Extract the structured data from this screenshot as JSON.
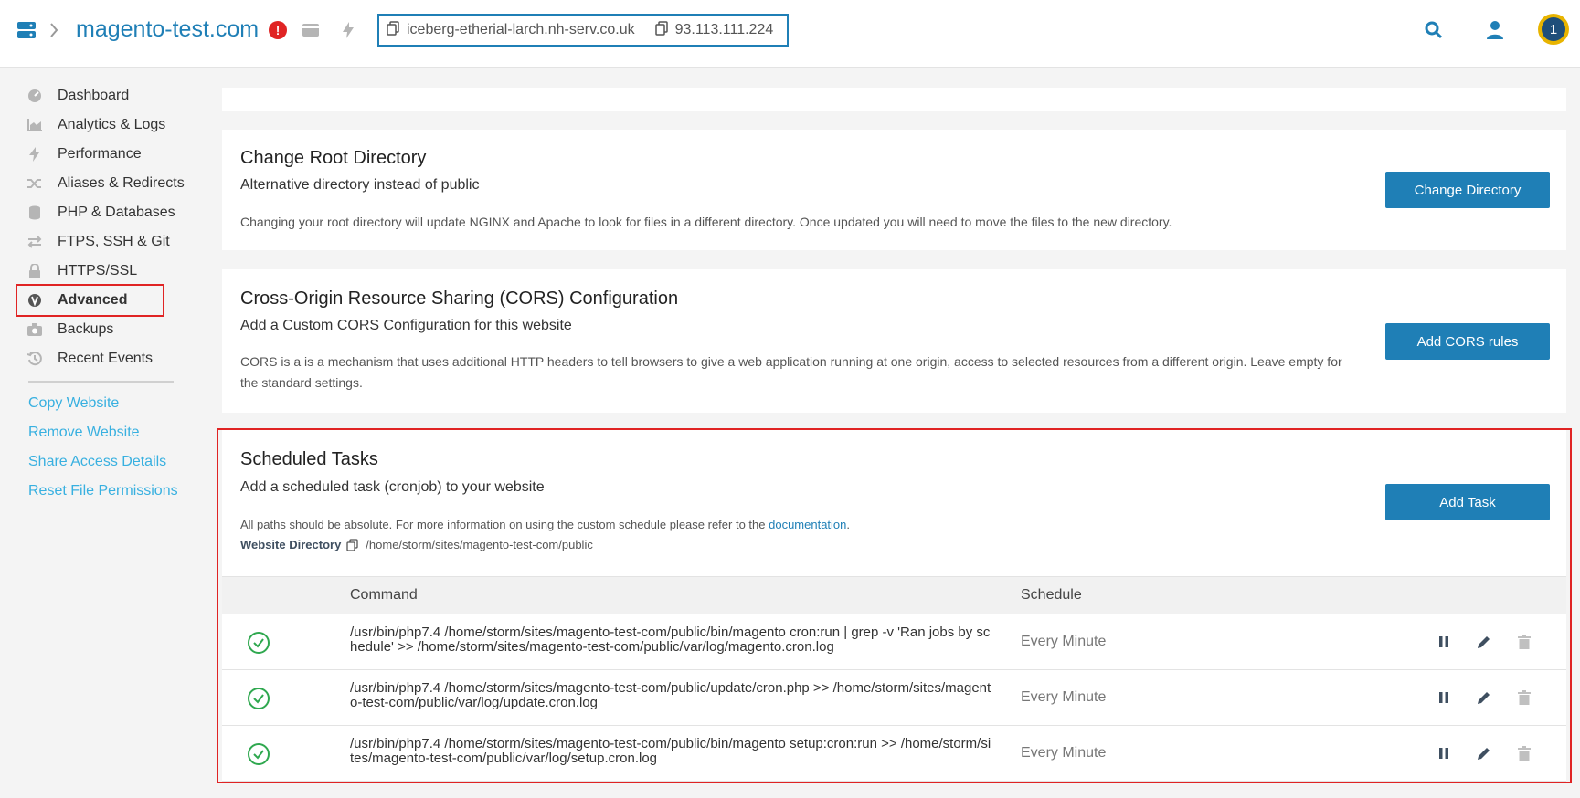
{
  "header": {
    "site_name": "magento-test.com",
    "alert_count": "!",
    "hostname": "iceberg-etherial-larch.nh-serv.co.uk",
    "ip_address": "93.113.111.224",
    "avatar_badge": "1"
  },
  "sidebar": {
    "items": [
      {
        "label": "Dashboard",
        "icon": "dashboard-icon"
      },
      {
        "label": "Analytics & Logs",
        "icon": "chart-icon"
      },
      {
        "label": "Performance",
        "icon": "bolt-icon"
      },
      {
        "label": "Aliases & Redirects",
        "icon": "shuffle-icon"
      },
      {
        "label": "PHP & Databases",
        "icon": "database-icon"
      },
      {
        "label": "FTPS, SSH & Git",
        "icon": "transfer-icon"
      },
      {
        "label": "HTTPS/SSL",
        "icon": "lock-icon"
      },
      {
        "label": "Advanced",
        "icon": "advanced-icon"
      },
      {
        "label": "Backups",
        "icon": "camera-icon"
      },
      {
        "label": "Recent Events",
        "icon": "history-icon"
      }
    ],
    "links": [
      "Copy Website",
      "Remove Website",
      "Share Access Details",
      "Reset File Permissions"
    ]
  },
  "root_dir": {
    "title": "Change Root Directory",
    "subtitle": "Alternative directory instead of public",
    "description": "Changing your root directory will update NGINX and Apache to look for files in a different directory. Once updated you will need to move the files to the new directory.",
    "button": "Change Directory"
  },
  "cors": {
    "title": "Cross-Origin Resource Sharing (CORS) Configuration",
    "subtitle": "Add a Custom CORS Configuration for this website",
    "description": "CORS is a is a mechanism that uses additional HTTP headers to tell browsers to give a web application running at one origin, access to selected resources from a different origin. Leave empty for the standard settings.",
    "button": "Add CORS rules"
  },
  "scheduled": {
    "title": "Scheduled Tasks",
    "subtitle": "Add a scheduled task (cronjob) to your website",
    "info_prefix": "All paths should be absolute. For more information on using the custom schedule please refer to the ",
    "info_link": "documentation",
    "info_suffix": ".",
    "webdir_label": "Website Directory",
    "webdir_path": "/home/storm/sites/magento-test-com/public",
    "button": "Add Task",
    "columns": {
      "command": "Command",
      "schedule": "Schedule"
    },
    "tasks": [
      {
        "command": "/usr/bin/php7.4 /home/storm/sites/magento-test-com/public/bin/magento cron:run | grep -v 'Ran jobs by schedule' >> /home/storm/sites/magento-test-com/public/var/log/magento.cron.log",
        "schedule": "Every Minute"
      },
      {
        "command": "/usr/bin/php7.4 /home/storm/sites/magento-test-com/public/update/cron.php >> /home/storm/sites/magento-test-com/public/var/log/update.cron.log",
        "schedule": "Every Minute"
      },
      {
        "command": "/usr/bin/php7.4 /home/storm/sites/magento-test-com/public/bin/magento setup:cron:run >> /home/storm/sites/magento-test-com/public/var/log/setup.cron.log",
        "schedule": "Every Minute"
      }
    ]
  },
  "colors": {
    "accent": "#1f7fb6",
    "link": "#38b0e0",
    "alert": "#e02424",
    "success": "#2fa84f"
  }
}
